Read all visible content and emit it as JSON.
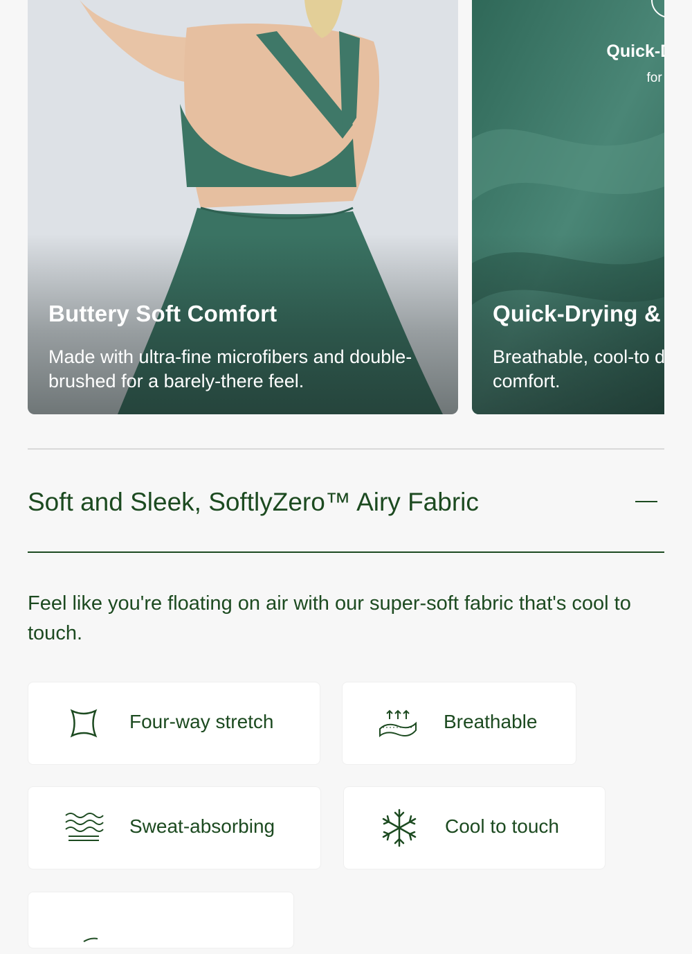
{
  "carousel": {
    "cards": [
      {
        "title": "Buttery Soft Comfort",
        "text": "Made with ultra-fine microfibers and double-brushed for a barely-there feel.",
        "image": "green-dress-back-photo"
      },
      {
        "title": "Quick-Drying & ",
        "text": "Breathable, cool-to day comfort.",
        "badge_line1": "Quick-Dr",
        "badge_line2": "for All",
        "image": "green-fabric-photo"
      }
    ]
  },
  "accordion": {
    "title": "Soft and Sleek, SoftlyZero™ Airy Fabric",
    "toggle_icon": "minus-icon",
    "description": "Feel like you're floating on air with our super-soft fabric that's cool to touch."
  },
  "features": [
    {
      "label": "Four-way stretch",
      "icon": "four-way-stretch-icon"
    },
    {
      "label": "Breathable",
      "icon": "breathable-icon"
    },
    {
      "label": "Sweat-absorbing",
      "icon": "sweat-absorbing-icon"
    },
    {
      "label": "Cool to touch",
      "icon": "snowflake-icon"
    },
    {
      "label": "",
      "icon": "feather-icon"
    }
  ],
  "colors": {
    "brand_green": "#1c4a20",
    "fabric_green": "#3a7565",
    "background": "#f7f7f7"
  }
}
